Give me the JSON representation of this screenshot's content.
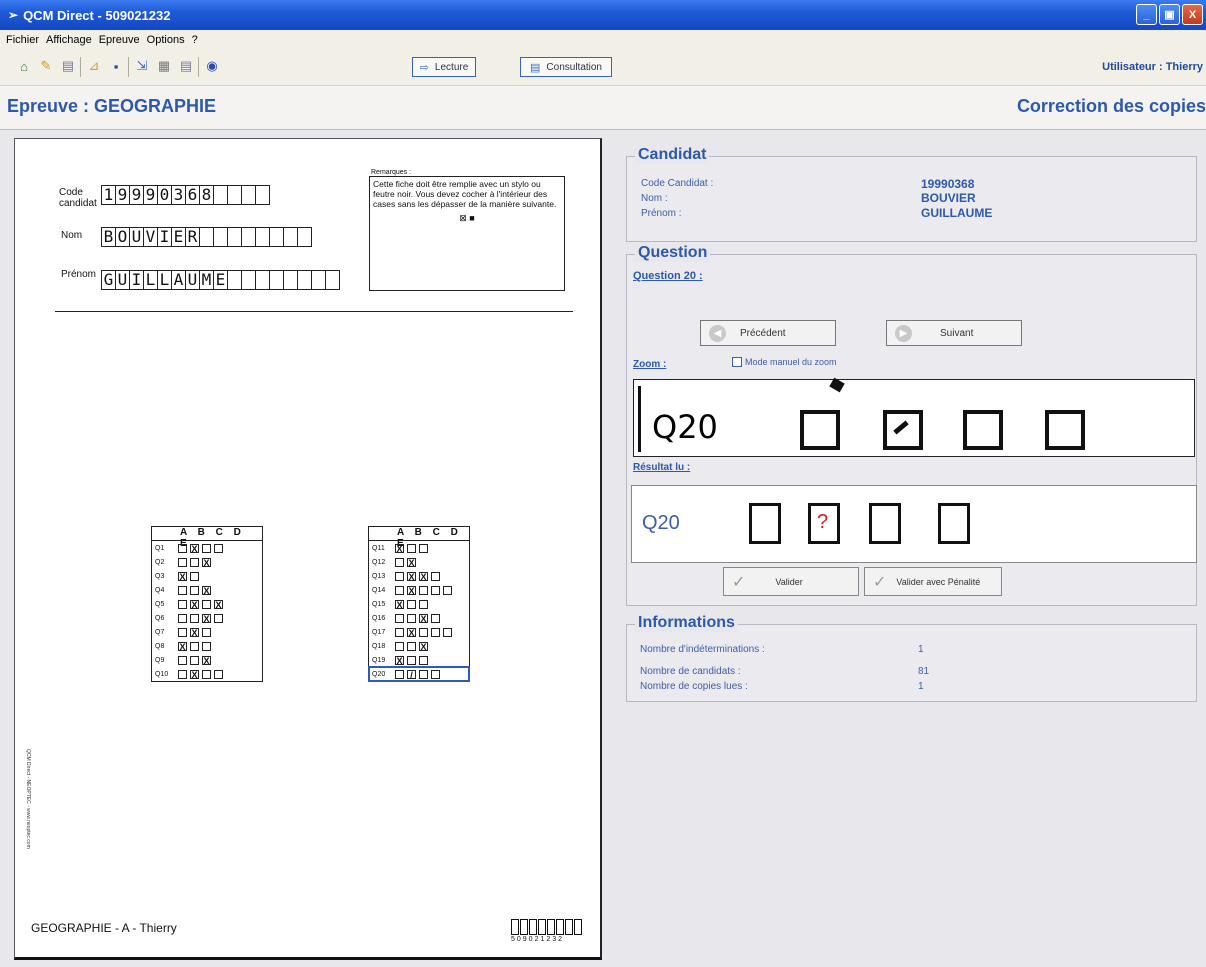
{
  "window": {
    "title": "QCM Direct - 509021232",
    "min_label": "_",
    "max_label": "▣",
    "close_label": "X"
  },
  "menu": [
    "Fichier",
    "Affichage",
    "Epreuve",
    "Options",
    "?"
  ],
  "toolbar": {
    "lecture_label": "Lecture",
    "consultation_label": "Consultation",
    "user_label": "Utilisateur : Thierry"
  },
  "header": {
    "epreuve": "Epreuve : GEOGRAPHIE",
    "correction": "Correction des copies"
  },
  "sheet": {
    "code_label_1": "Code",
    "code_label_2": "candidat",
    "code_chars": [
      "1",
      "9",
      "9",
      "9",
      "0",
      "3",
      "6",
      "8",
      "",
      "",
      "",
      ""
    ],
    "nom_label": "Nom",
    "nom_chars": [
      "B",
      "O",
      "U",
      "V",
      "I",
      "E",
      "R",
      "",
      "",
      "",
      "",
      "",
      "",
      "",
      ""
    ],
    "prenom_label": "Prénom",
    "prenom_chars": [
      "G",
      "U",
      "I",
      "L",
      "L",
      "A",
      "U",
      "M",
      "E",
      "",
      "",
      "",
      "",
      "",
      "",
      "",
      ""
    ],
    "remarks_title": "Remarques :",
    "remarks_text": "Cette fiche doit être remplie avec un stylo ou feutre noir. Vous devez cocher à l'intérieur des cases sans les dépasser de la manière suivante.",
    "remarks_marks": "⊠ ■",
    "grid_header": "A B C D E",
    "left_questions": [
      {
        "q": "Q1",
        "boxes": [
          "",
          "X",
          "",
          ""
        ]
      },
      {
        "q": "Q2",
        "boxes": [
          "",
          "",
          "X"
        ]
      },
      {
        "q": "Q3",
        "boxes": [
          "X",
          ""
        ]
      },
      {
        "q": "Q4",
        "boxes": [
          "",
          "",
          "X"
        ]
      },
      {
        "q": "Q5",
        "boxes": [
          "",
          "X",
          "",
          "X"
        ]
      },
      {
        "q": "Q6",
        "boxes": [
          "",
          "",
          "X",
          ""
        ]
      },
      {
        "q": "Q7",
        "boxes": [
          "",
          "X",
          ""
        ]
      },
      {
        "q": "Q8",
        "boxes": [
          "X",
          "",
          ""
        ]
      },
      {
        "q": "Q9",
        "boxes": [
          "",
          "",
          "X"
        ]
      },
      {
        "q": "Q10",
        "boxes": [
          "",
          "X",
          "",
          ""
        ]
      }
    ],
    "right_questions": [
      {
        "q": "Q11",
        "boxes": [
          "X",
          "",
          ""
        ]
      },
      {
        "q": "Q12",
        "boxes": [
          "",
          "X"
        ]
      },
      {
        "q": "Q13",
        "boxes": [
          "",
          "X",
          "X",
          ""
        ]
      },
      {
        "q": "Q14",
        "boxes": [
          "",
          "X",
          "",
          "",
          ""
        ]
      },
      {
        "q": "Q15",
        "boxes": [
          "X",
          "",
          ""
        ]
      },
      {
        "q": "Q16",
        "boxes": [
          "",
          "",
          "X",
          ""
        ]
      },
      {
        "q": "Q17",
        "boxes": [
          "",
          "X",
          "",
          "",
          ""
        ]
      },
      {
        "q": "Q18",
        "boxes": [
          "",
          "",
          "X"
        ]
      },
      {
        "q": "Q19",
        "boxes": [
          "X",
          "",
          ""
        ]
      },
      {
        "q": "Q20",
        "boxes": [
          "",
          "/",
          "",
          ""
        ]
      }
    ],
    "side_text": "QCM Direct - NEOPTEC - www.neoptec.com",
    "footer": "GEOGRAPHIE - A - Thierry",
    "barcode_number": "509021232"
  },
  "candidat": {
    "title": "Candidat",
    "code_label": "Code Candidat :",
    "nom_label": "Nom :",
    "prenom_label": "Prénom :",
    "code": "19990368",
    "nom": "BOUVIER",
    "prenom": "GUILLAUME"
  },
  "question": {
    "title": "Question",
    "current": "Question 20 :",
    "prev_label": "Précédent",
    "next_label": "Suivant",
    "zoom_label": "Zoom :",
    "zoom_manual_label": "Mode manuel du zoom",
    "zoom_q": "Q20",
    "result_label": "Résultat lu :",
    "result_q": "Q20",
    "result_mark": "?",
    "validate_label": "Valider",
    "validate_penalty_label": "Valider avec Pénalité"
  },
  "informations": {
    "title": "Informations",
    "indet_label": "Nombre d'indéterminations :",
    "indet_value": "1",
    "candidats_label": "Nombre de candidats :",
    "candidats_value": "81",
    "copies_label": "Nombre de copies lues :",
    "copies_value": "1"
  }
}
